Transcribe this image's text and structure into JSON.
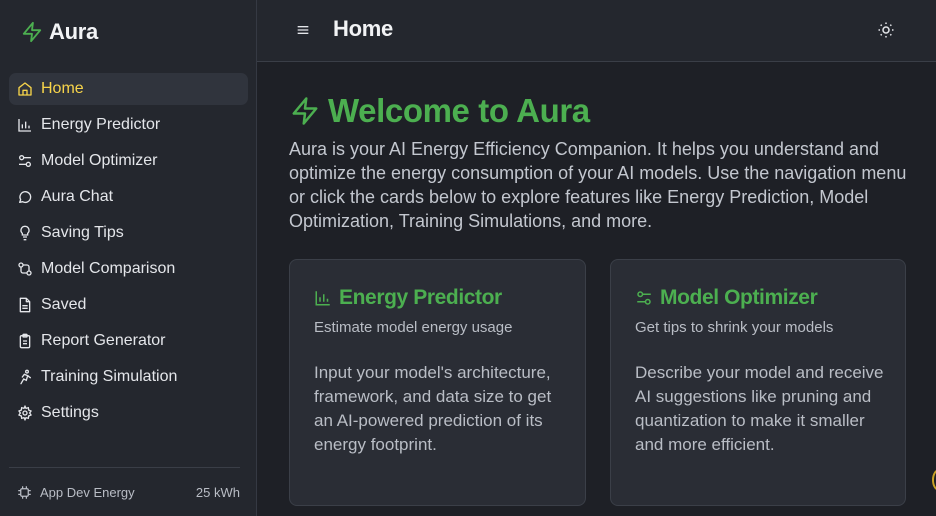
{
  "app": {
    "name": "Aura"
  },
  "sidebar": {
    "items": [
      {
        "label": "Home",
        "icon": "home-icon",
        "active": true
      },
      {
        "label": "Energy Predictor",
        "icon": "chart-bars-icon"
      },
      {
        "label": "Model Optimizer",
        "icon": "sliders-icon"
      },
      {
        "label": "Aura Chat",
        "icon": "chat-bubble-icon"
      },
      {
        "label": "Saving Tips",
        "icon": "lightbulb-icon"
      },
      {
        "label": "Model Comparison",
        "icon": "compare-icon"
      },
      {
        "label": "Saved",
        "icon": "document-icon"
      },
      {
        "label": "Report Generator",
        "icon": "clipboard-icon"
      },
      {
        "label": "Training Simulation",
        "icon": "runner-icon"
      },
      {
        "label": "Settings",
        "icon": "gear-icon"
      }
    ],
    "footer": {
      "label": "App Dev Energy",
      "value": "25 kWh",
      "icon": "chip-icon"
    }
  },
  "header": {
    "title": "Home",
    "menu_icon": "hamburger-menu-icon",
    "theme_icon": "sun-icon"
  },
  "main": {
    "hero_title": "Welcome to Aura",
    "intro": "Aura is your AI Energy Efficiency Companion. It helps you understand and optimize the energy consumption of your AI models. Use the navigation menu or click the cards below to explore features like Energy Prediction, Model Optimization, Training Simulations, and more.",
    "cards": [
      {
        "title": "Energy Predictor",
        "subtitle": "Estimate model energy usage",
        "body": "Input your model's architecture, framework, and data size to get an AI-powered prediction of its energy footprint.",
        "icon": "chart-bars-icon"
      },
      {
        "title": "Model Optimizer",
        "subtitle": "Get tips to shrink your models",
        "body": "Describe your model and receive AI suggestions like pruning and quantization to make it smaller and more efficient.",
        "icon": "sliders-icon"
      }
    ]
  },
  "colors": {
    "accent_green": "#4caf50",
    "active_yellow": "#f7d44a",
    "background": "#1e2026",
    "sidebar_bg": "#24272e"
  }
}
